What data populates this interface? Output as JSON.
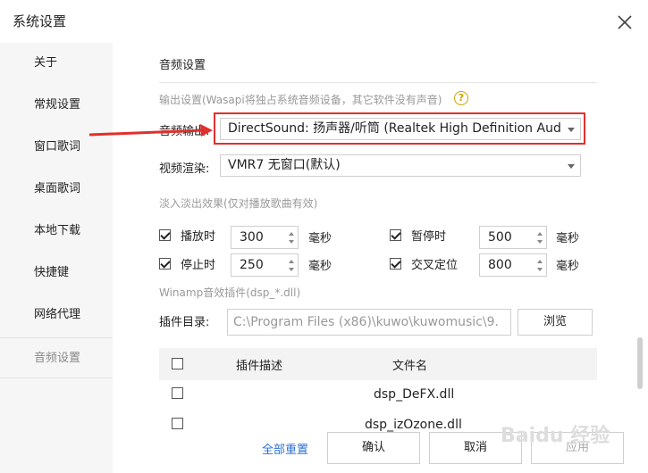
{
  "window": {
    "title": "系统设置",
    "close_icon": "close-icon"
  },
  "sidebar": {
    "items": [
      {
        "label": "关于",
        "active": false
      },
      {
        "label": "常规设置",
        "active": false
      },
      {
        "label": "窗口歌词",
        "active": false
      },
      {
        "label": "桌面歌词",
        "active": false
      },
      {
        "label": "本地下载",
        "active": false
      },
      {
        "label": "快捷键",
        "active": false
      },
      {
        "label": "网络代理",
        "active": false
      },
      {
        "label": "音频设置",
        "active": true
      }
    ]
  },
  "main": {
    "section_title": "音频设置",
    "output_hint": "输出设置(Wasapi将独占系统音频设备，其它软件没有声音)",
    "help_icon": "?",
    "audio_output_label": "音频输出:",
    "audio_output_value": "DirectSound: 扬声器/听筒 (Realtek High Definition Audio)",
    "video_render_label": "视频渲染:",
    "video_render_value": "VMR7 无窗口(默认)",
    "fade_hint": "淡入淡出效果(仅对播放歌曲有效)",
    "fades": [
      {
        "label": "播放时",
        "checked": true,
        "value": "300",
        "unit": "毫秒"
      },
      {
        "label": "暂停时",
        "checked": true,
        "value": "500",
        "unit": "毫秒"
      },
      {
        "label": "停止时",
        "checked": true,
        "value": "250",
        "unit": "毫秒"
      },
      {
        "label": "交叉定位",
        "checked": true,
        "value": "800",
        "unit": "毫秒"
      }
    ],
    "winamp_hint": "Winamp音效插件(dsp_*.dll)",
    "plugin_dir_label": "插件目录:",
    "plugin_dir_value": "C:\\Program Files (x86)\\kuwo\\kuwomusic\\9.",
    "browse_label": "浏览",
    "table": {
      "columns": [
        "插件描述",
        "文件名"
      ],
      "rows": [
        {
          "checked": false,
          "desc": "",
          "file": "dsp_DeFX.dll"
        },
        {
          "checked": false,
          "desc": "",
          "file": "dsp_izOzone.dll"
        }
      ]
    }
  },
  "footer": {
    "reset_label": "全部重置",
    "ok_label": "确认",
    "cancel_label": "取消",
    "apply_label": "应用"
  },
  "watermark": "Baidu 经验",
  "colors": {
    "highlight_border": "#e0302c",
    "link": "#2b6fd6",
    "hint_text": "#999999",
    "sidebar_bg": "#f6f6f6"
  }
}
